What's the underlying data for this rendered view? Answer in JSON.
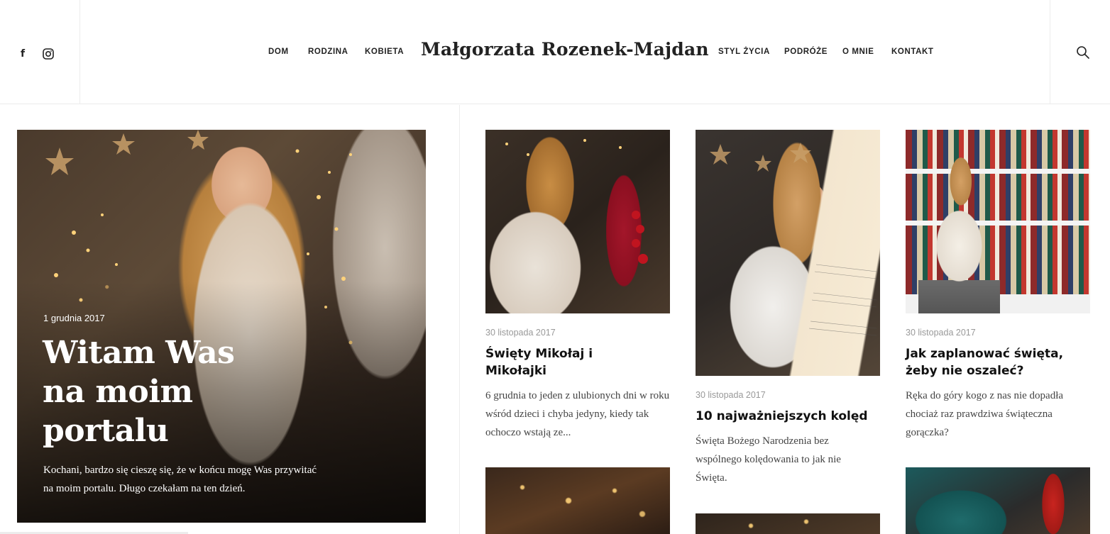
{
  "header": {
    "brand": "Małgorzata Rozenek-Majdan",
    "nav_left": [
      "DOM",
      "RODZINA",
      "KOBIETA"
    ],
    "nav_right": [
      "STYL ŻYCIA",
      "PODRÓŻE",
      "O MNIE",
      "KONTAKT"
    ],
    "social_icons": [
      "facebook-icon",
      "instagram-icon"
    ],
    "search_icon": "search-icon"
  },
  "hero": {
    "date": "1 grudnia 2017",
    "title": "Witam Was na moim portalu",
    "excerpt": "Kochani, bardzo się cieszę się, że w końcu mogę Was przywitać na moim portalu. Długo czekałam na ten dzień."
  },
  "posts": [
    {
      "date": "30 listopada 2017",
      "title": "Święty Mikołaj i Mikołajki",
      "excerpt": "6 grudnia to jeden z ulubionych dni w roku wśród dzieci i chyba jedyny, kiedy tak ochoczo wstają ze..."
    },
    {
      "date": "30 listopada 2017",
      "title": "10 najważniejszych kolęd",
      "excerpt": "Święta Bożego Narodzenia bez wspólnego kolędowania to jak nie Święta."
    },
    {
      "date": "30 listopada 2017",
      "title": "Jak zaplanować święta, żeby nie oszaleć?",
      "excerpt": "Ręka do góry kogo z nas nie dopadła chociaż raz prawdziwa świąteczna gorączka?"
    }
  ],
  "colors": {
    "text": "#222222",
    "meta": "#999999",
    "border": "#ececec"
  }
}
